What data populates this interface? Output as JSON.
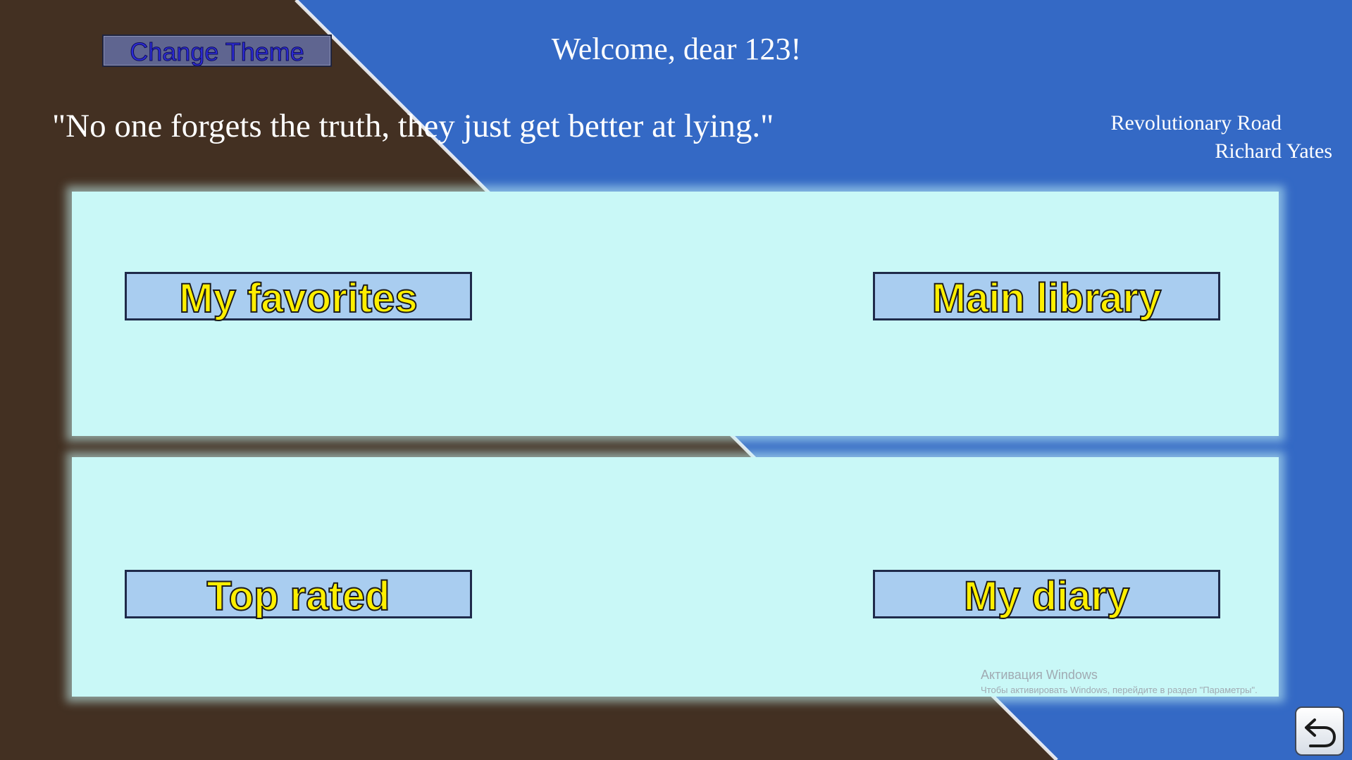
{
  "header": {
    "theme_button_label": "Change Theme",
    "welcome_text": "Welcome, dear 123!"
  },
  "quote": {
    "text": "\"No one forgets the truth, they just get better at lying.\"",
    "book_title": "Revolutionary Road",
    "book_author": "Richard Yates"
  },
  "menu": {
    "favorites_label": "My favorites",
    "library_label": "Main library",
    "top_rated_label": "Top rated",
    "diary_label": "My diary"
  },
  "watermark": {
    "title": "Активация Windows",
    "subtitle": "Чтобы активировать Windows, перейдите в раздел \"Параметры\"."
  },
  "footer": {
    "back_icon": "back-arrow-icon"
  },
  "colors": {
    "background_dark": "#433022",
    "background_blue": "#3469c5",
    "panel": "#c9f8f7",
    "nav_button": "#a9cdf0",
    "nav_text": "#ffef00",
    "theme_button": "#5f6590",
    "theme_text": "#2d2bd6"
  }
}
